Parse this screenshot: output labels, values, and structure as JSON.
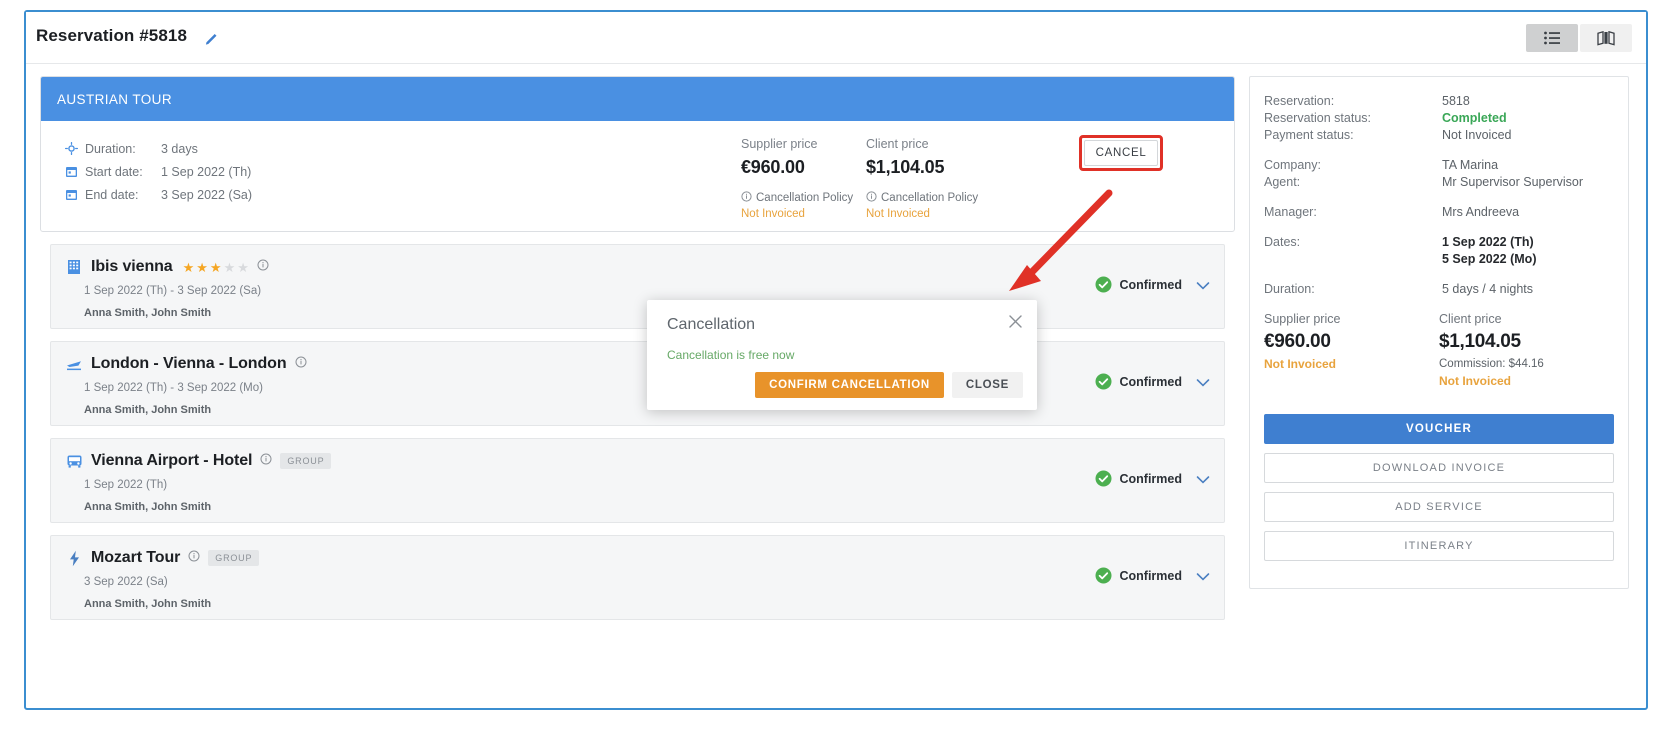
{
  "header": {
    "title": "Reservation #5818",
    "edit_icon": "pencil-icon",
    "view_list_icon": "list-view-icon",
    "view_map_icon": "map-view-icon"
  },
  "tour": {
    "banner_title": "AUSTRIAN TOUR",
    "details": [
      {
        "icon": "sun-icon",
        "label": "Duration:",
        "value": "3 days"
      },
      {
        "icon": "calendar-icon",
        "label": "Start date:",
        "value": "1 Sep 2022 (Th)"
      },
      {
        "icon": "calendar-icon",
        "label": "End date:",
        "value": "3 Sep 2022 (Sa)"
      }
    ],
    "supplier": {
      "label": "Supplier price",
      "amount": "€960.00",
      "policy": "Cancellation Policy",
      "status": "Not Invoiced"
    },
    "client": {
      "label": "Client price",
      "amount": "$1,104.05",
      "policy": "Cancellation Policy",
      "status": "Not Invoiced"
    },
    "cancel_label": "CANCEL"
  },
  "services": [
    {
      "icon": "hotel-icon",
      "name": "Ibis vienna",
      "stars_filled": 3,
      "stars_total": 5,
      "has_info": true,
      "tag": "",
      "dates": "1 Sep 2022 (Th) - 3 Sep 2022 (Sa)",
      "passengers": "Anna Smith, John Smith",
      "status": "Confirmed"
    },
    {
      "icon": "flight-icon",
      "name": "London - Vienna - London",
      "stars_filled": 0,
      "stars_total": 0,
      "has_info": true,
      "tag": "",
      "dates": "1 Sep 2022 (Th) - 3 Sep 2022 (Mo)",
      "passengers": "Anna Smith, John Smith",
      "status": "Confirmed"
    },
    {
      "icon": "transfer-bus-icon",
      "name": "Vienna Airport - Hotel",
      "stars_filled": 0,
      "stars_total": 0,
      "has_info": true,
      "tag": "GROUP",
      "dates": "1 Sep 2022 (Th)",
      "passengers": "Anna Smith, John Smith",
      "status": "Confirmed"
    },
    {
      "icon": "activity-bolt-icon",
      "name": "Mozart Tour",
      "stars_filled": 0,
      "stars_total": 0,
      "has_info": true,
      "tag": "GROUP",
      "dates": "3 Sep 2022 (Sa)",
      "passengers": "Anna Smith, John Smith",
      "status": "Confirmed"
    }
  ],
  "sidebar": {
    "fields": [
      {
        "key": "Reservation:",
        "value": "5818",
        "style": "normal"
      },
      {
        "key": "Reservation status:",
        "value": "Completed",
        "style": "green"
      },
      {
        "key": "Payment status:",
        "value": "Not Invoiced",
        "style": "normal"
      },
      {
        "key": "Company:",
        "value": "TA Marina",
        "style": "normal"
      },
      {
        "key": "Agent:",
        "value": "Mr Supervisor Supervisor",
        "style": "normal"
      },
      {
        "key": "Manager:",
        "value": "Mrs Andreeva",
        "style": "normal"
      },
      {
        "key": "Dates:",
        "value": "1 Sep 2022 (Th)",
        "style": "bold"
      },
      {
        "key": "",
        "value": "5 Sep 2022 (Mo)",
        "style": "bold"
      },
      {
        "key": "Duration:",
        "value": "5 days / 4 nights",
        "style": "normal"
      }
    ],
    "supplier": {
      "label": "Supplier price",
      "amount": "€960.00",
      "status": "Not Invoiced"
    },
    "client": {
      "label": "Client price",
      "amount": "$1,104.05",
      "commission": "Commission: $44.16",
      "status": "Not Invoiced"
    },
    "actions": {
      "voucher": "VOUCHER",
      "download_invoice": "DOWNLOAD INVOICE",
      "add_service": "ADD SERVICE",
      "itinerary": "ITINERARY"
    }
  },
  "modal": {
    "title": "Cancellation",
    "message": "Cancellation is free now",
    "confirm_label": "CONFIRM CANCELLATION",
    "close_label": "CLOSE",
    "close_icon": "close-icon"
  },
  "annotation": {
    "arrow_color": "#e03127",
    "highlight_color": "#e03127"
  }
}
